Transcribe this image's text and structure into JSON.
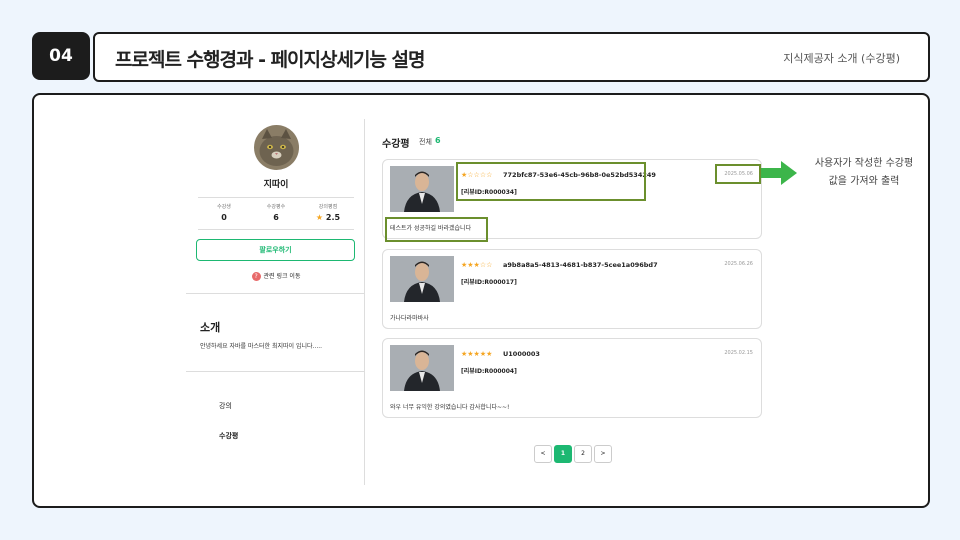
{
  "header": {
    "number": "04",
    "title": "프로젝트 수행경과 - 페이지상세기능 설명",
    "subtitle": "지식제공자 소개 (수강평)"
  },
  "profile": {
    "name": "지따이",
    "stats": [
      {
        "label": "수강생",
        "value": "0"
      },
      {
        "label": "수강평수",
        "value": "6"
      },
      {
        "label": "강의평점",
        "value": "2.5"
      }
    ],
    "follow_label": "팔로우하기",
    "link_label": "관련 링크 이동"
  },
  "intro": {
    "title": "소개",
    "text": "안녕하세요 자바를 마스터한 최지따이 입니다....."
  },
  "nav": {
    "items": [
      "강의",
      "수강평"
    ]
  },
  "reviews": {
    "title": "수강평",
    "total_label": "전체",
    "total_count": "6",
    "items": [
      {
        "stars": "★☆☆☆☆",
        "rating": 1,
        "id": "772bfc87-53e6-45cb-96b8-0e52bd534249",
        "code": "[리뷰ID:R000034]",
        "date": "2025.05.06",
        "content": "테스트가 성공하길 바라겠습니다"
      },
      {
        "stars": "★★★☆☆",
        "rating": 3,
        "id": "a9b8a8a5-4813-4681-b837-5cee1a096bd7",
        "code": "[리뷰ID:R000017]",
        "date": "2025.06.26",
        "content": "가나다라마바사"
      },
      {
        "stars": "★★★★★",
        "rating": 5,
        "id": "U1000003",
        "code": "[리뷰ID:R000004]",
        "date": "2025.02.15",
        "content": "와우 너무 유익한 강의였습니다 감사합니다~~!"
      }
    ]
  },
  "annotation": {
    "line1": "사용자가 작성한 수강평",
    "line2": "값을 가져와 출력"
  },
  "pagination": {
    "prev": "<",
    "pages": [
      "1",
      "2"
    ],
    "next": ">",
    "current": "1"
  },
  "colors": {
    "accent": "#1db872",
    "highlight": "#6b8f2d",
    "star": "#f5a623",
    "dark": "#1c1c1c"
  }
}
